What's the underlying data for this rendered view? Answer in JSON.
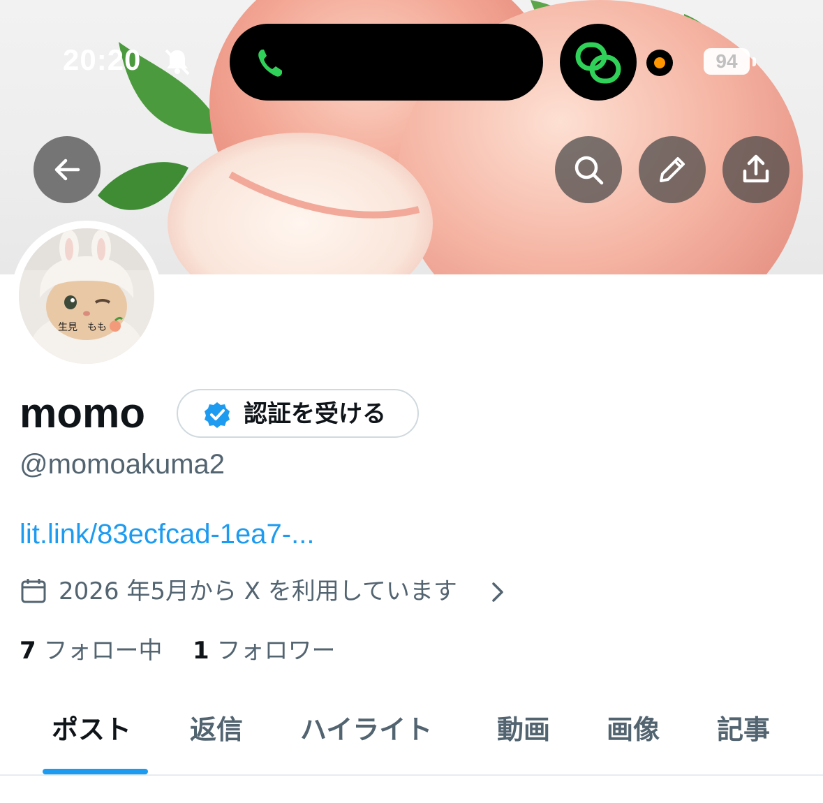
{
  "status_bar": {
    "time": "20:20",
    "battery": "94"
  },
  "header": {
    "banner_description": "peach-banner-image"
  },
  "profile": {
    "display_name": "momo",
    "verify_button_label": "認証を受ける",
    "handle": "@momoakuma2",
    "link": "lit.link/83ecfcad-1ea7-...",
    "joined": "2026 年5月から X を利用しています",
    "following_count": "7",
    "following_label": "フォロー中",
    "followers_count": "1",
    "followers_label": "フォロワー",
    "avatar_text": "生見　もも"
  },
  "tabs": [
    {
      "label": "ポスト",
      "active": true
    },
    {
      "label": "返信",
      "active": false
    },
    {
      "label": "ハイライト",
      "active": false
    },
    {
      "label": "動画",
      "active": false
    },
    {
      "label": "画像",
      "active": false
    },
    {
      "label": "記事",
      "active": false
    }
  ],
  "colors": {
    "accent": "#1d9bf0",
    "secondary_text": "#536471",
    "primary_text": "#0f1419",
    "call_green": "#30d158",
    "mic_dot": "#ff9500"
  }
}
